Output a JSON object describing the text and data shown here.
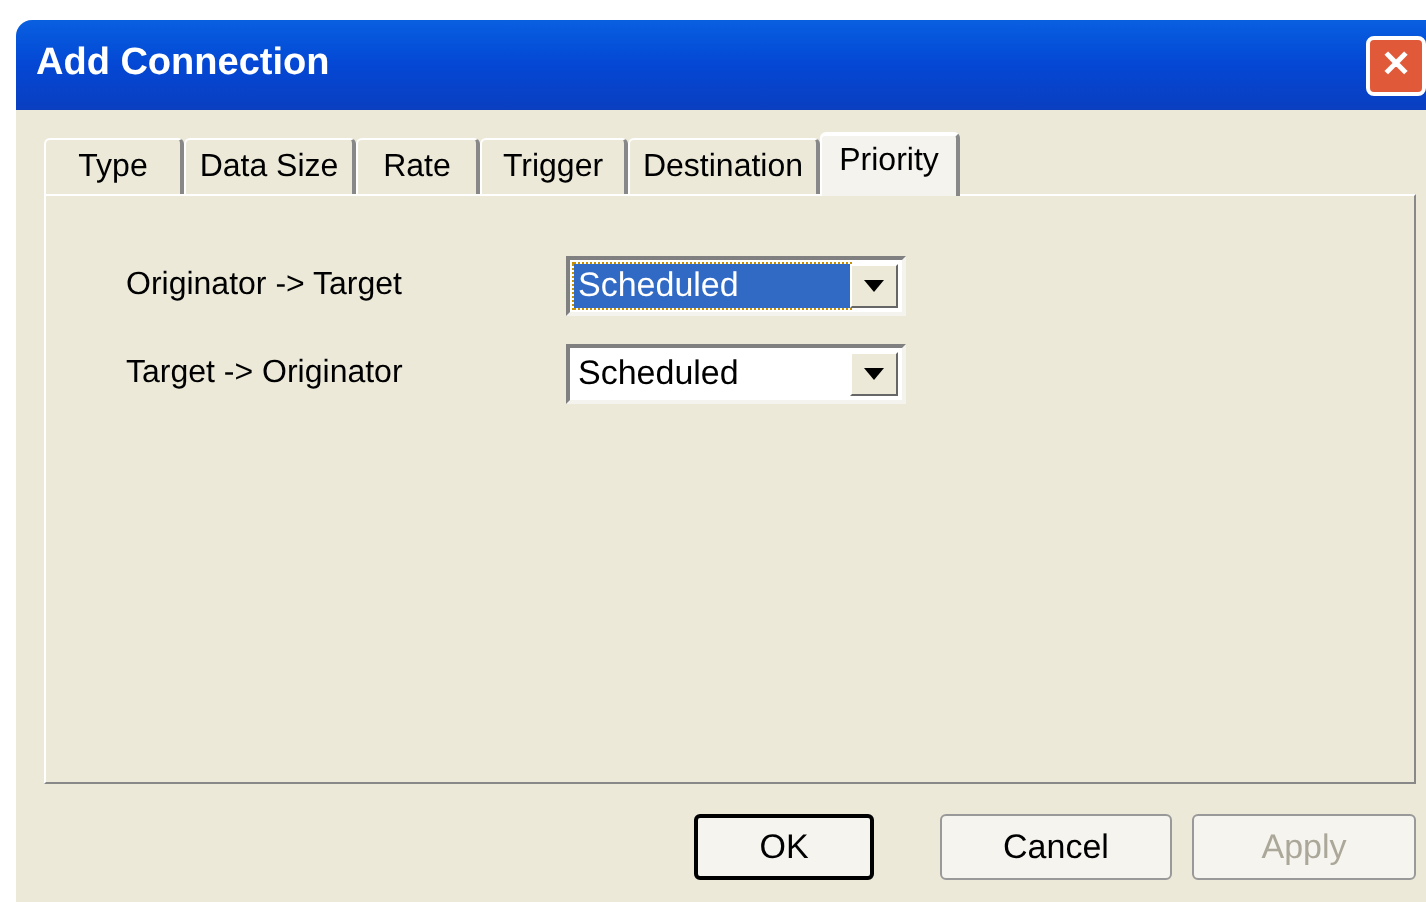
{
  "window": {
    "title": "Add Connection",
    "close": "✕"
  },
  "tabs": [
    {
      "label": "Type",
      "selected": false
    },
    {
      "label": "Data Size",
      "selected": false
    },
    {
      "label": "Rate",
      "selected": false
    },
    {
      "label": "Trigger",
      "selected": false
    },
    {
      "label": "Destination",
      "selected": false
    },
    {
      "label": "Priority",
      "selected": true
    }
  ],
  "fields": [
    {
      "label": "Originator -> Target",
      "value": "Scheduled",
      "focused": true
    },
    {
      "label": "Target -> Originator",
      "value": "Scheduled",
      "focused": false
    }
  ],
  "buttons": [
    {
      "label": "OK",
      "default": true,
      "disabled": false
    },
    {
      "label": "Cancel",
      "default": false,
      "disabled": false
    },
    {
      "label": "Apply",
      "default": false,
      "disabled": true
    }
  ]
}
